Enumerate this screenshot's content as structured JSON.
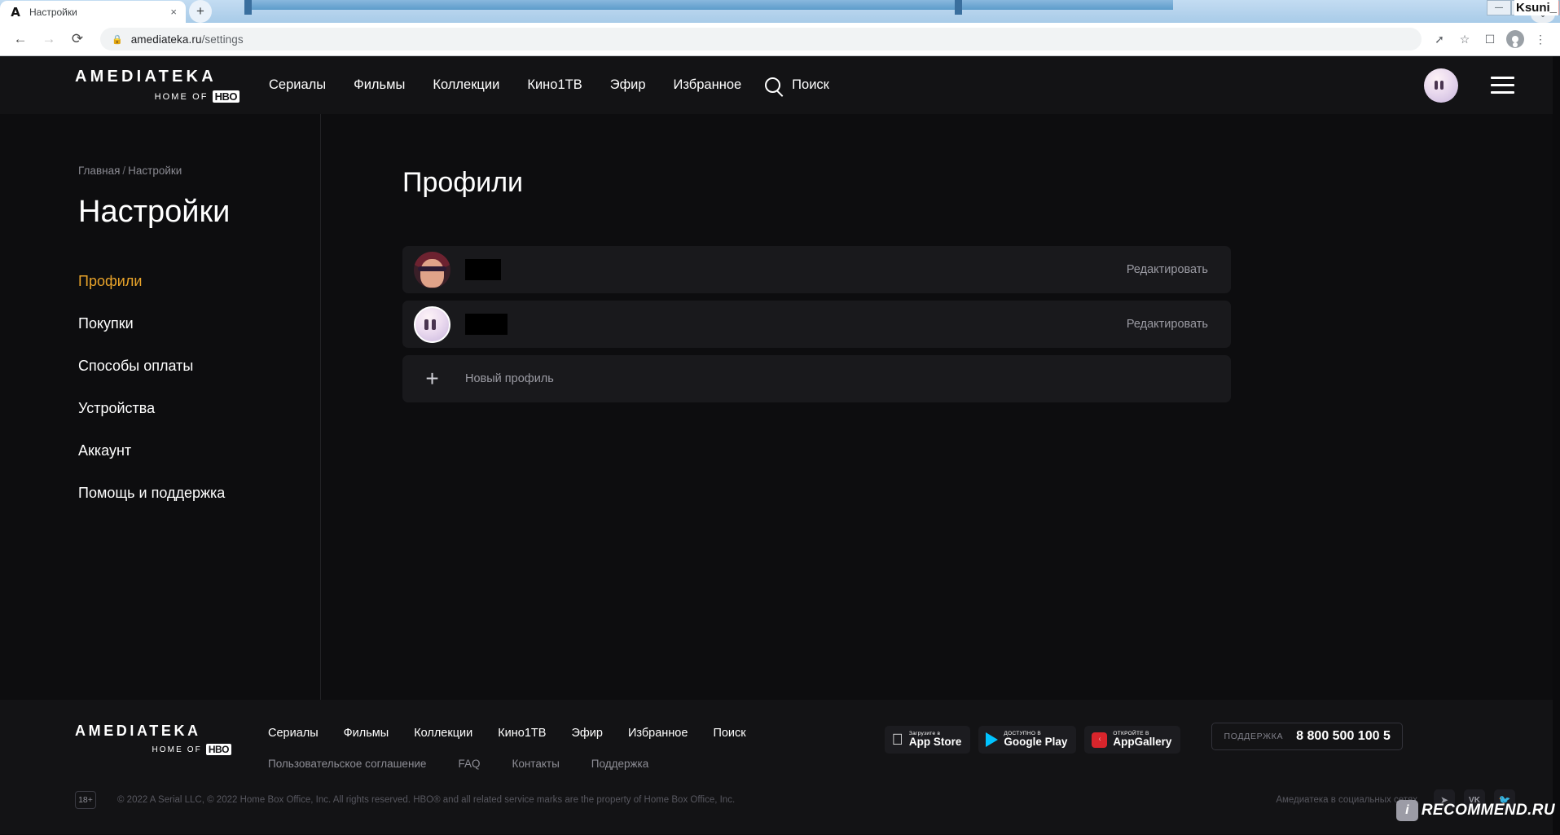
{
  "browser": {
    "tab": {
      "title": "Настройки",
      "favicon": "amediateka-a-icon",
      "close_label": "×"
    },
    "new_tab_label": "+",
    "tab_list_label": "⌄",
    "window_controls": {
      "minimize": "—",
      "maximize": "▭",
      "close": "×"
    },
    "user_label": "Ksuni_",
    "nav": {
      "back": "←",
      "forward": "→",
      "reload": "⟳"
    },
    "omnibox": {
      "lock": "🔒",
      "domain": "amediateka.ru",
      "path": "/settings"
    },
    "toolbar_icons": [
      "share-icon",
      "bookmark-star-icon",
      "sidebar-icon",
      "profile-avatar-icon",
      "kebab-menu-icon"
    ]
  },
  "header": {
    "logo": {
      "main": "AMEDIATEKA",
      "sub": "HOME OF",
      "badge": "HBO"
    },
    "nav": [
      {
        "label": "Сериалы"
      },
      {
        "label": "Фильмы"
      },
      {
        "label": "Коллекции"
      },
      {
        "label": "Кино1ТВ"
      },
      {
        "label": "Эфир"
      },
      {
        "label": "Избранное"
      }
    ],
    "search": {
      "label": "Поиск",
      "icon": "search-icon"
    },
    "avatar_icon": "ghost-avatar",
    "menu_icon": "hamburger-menu-icon"
  },
  "sidebar": {
    "breadcrumb": {
      "home": "Главная",
      "sep": "/",
      "current": "Настройки"
    },
    "title": "Настройки",
    "items": [
      {
        "label": "Профили",
        "active": true
      },
      {
        "label": "Покупки",
        "active": false
      },
      {
        "label": "Способы оплаты",
        "active": false
      },
      {
        "label": "Устройства",
        "active": false
      },
      {
        "label": "Аккаунт",
        "active": false
      },
      {
        "label": "Помощь и поддержка",
        "active": false
      }
    ]
  },
  "main": {
    "title": "Профили",
    "profiles": [
      {
        "name": "",
        "name_redacted": true,
        "avatar": "face-sunglasses-avatar",
        "edit_label": "Редактировать"
      },
      {
        "name": "",
        "name_redacted": true,
        "avatar": "ghost-avatar",
        "edit_label": "Редактировать"
      }
    ],
    "new_profile": {
      "label": "Новый профиль",
      "icon": "plus-icon"
    }
  },
  "footer": {
    "logo": {
      "main": "AMEDIATEKA",
      "sub": "HOME OF",
      "badge": "HBO"
    },
    "nav_primary": [
      "Сериалы",
      "Фильмы",
      "Коллекции",
      "Кино1ТВ",
      "Эфир",
      "Избранное",
      "Поиск"
    ],
    "nav_secondary": [
      "Пользовательское соглашение",
      "FAQ",
      "Контакты",
      "Поддержка"
    ],
    "store_badges": [
      {
        "small": "Загрузите в",
        "big": "App Store",
        "icon": "apple-icon"
      },
      {
        "small": "ДОСТУПНО В",
        "big": "Google Play",
        "icon": "google-play-icon"
      },
      {
        "small": "ОТКРОЙТЕ В",
        "big": "AppGallery",
        "icon": "huawei-appgallery-icon"
      }
    ],
    "support": {
      "label": "ПОДДЕРЖКА",
      "phone": "8 800 500 100 5"
    },
    "age_badge": "18+",
    "copyright": "© 2022 A Serial LLC, © 2022 Home Box Office, Inc. All rights reserved. HBO® and all related service marks are the property of Home Box Office, Inc.",
    "social": {
      "label": "Амедиатека в социальных сетях",
      "icons": [
        "telegram-icon",
        "vk-icon",
        "twitter-icon"
      ]
    }
  },
  "watermark": {
    "badge": "i",
    "text": "RECOMMEND.RU"
  },
  "colors": {
    "accent": "#e8a32a",
    "page_bg": "#0d0d0f",
    "panel_bg": "#19191c",
    "header_bg": "#131315"
  }
}
